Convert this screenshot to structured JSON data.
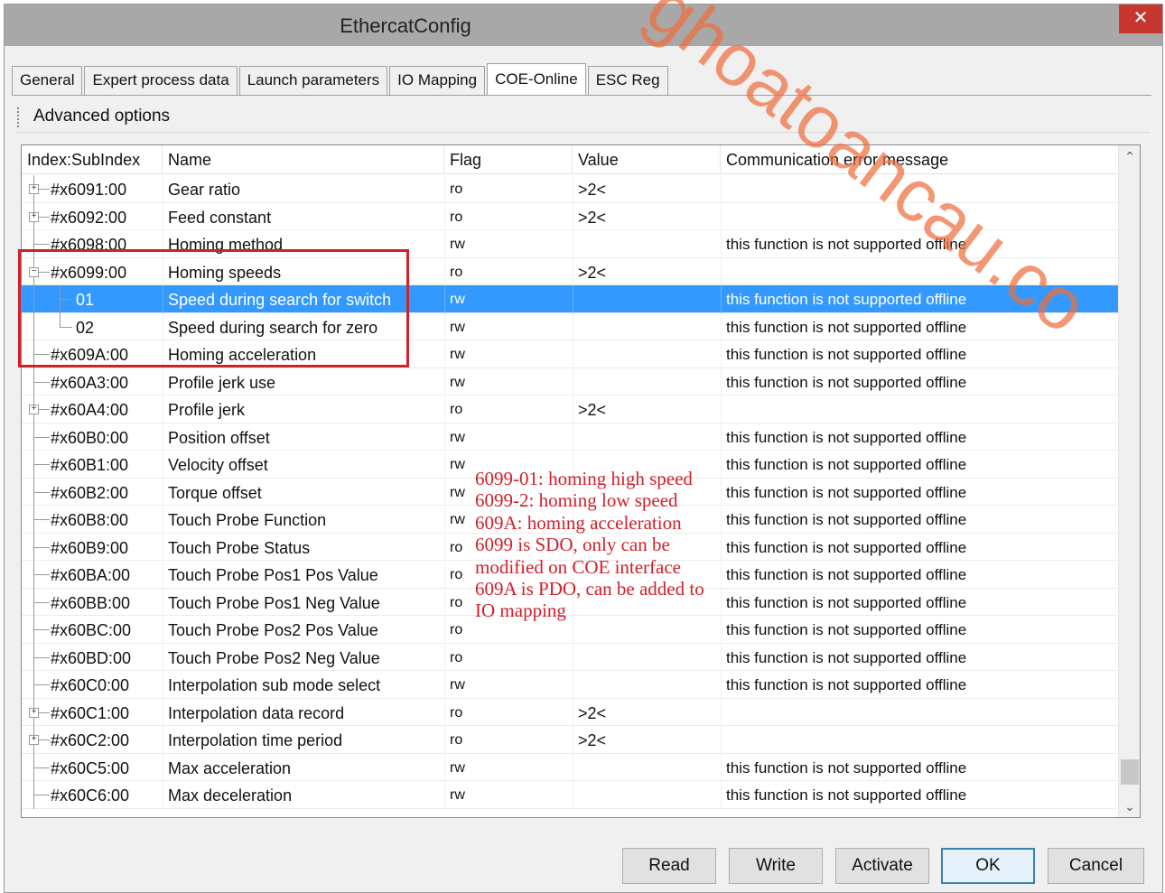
{
  "window": {
    "title": "EthercatConfig",
    "close_glyph": "✕"
  },
  "tabs": [
    {
      "label": "General"
    },
    {
      "label": "Expert process data"
    },
    {
      "label": "Launch parameters"
    },
    {
      "label": "IO Mapping"
    },
    {
      "label": "COE-Online",
      "active": true
    },
    {
      "label": "ESC Reg"
    }
  ],
  "advanced_options": {
    "label": "Advanced options"
  },
  "table": {
    "columns": [
      "Index:SubIndex",
      "Name",
      "Flag",
      "Value",
      "Communication error message"
    ],
    "rows": [
      {
        "index": "#x6091:00",
        "name": "Gear ratio",
        "flag": "ro",
        "value": ">2<",
        "error": "",
        "node": "expandable"
      },
      {
        "index": "#x6092:00",
        "name": "Feed constant",
        "flag": "ro",
        "value": ">2<",
        "error": "",
        "node": "expandable"
      },
      {
        "index": "#x6098:00",
        "name": "Homing method",
        "flag": "rw",
        "value": "",
        "error": "this function is not supported offline",
        "node": "leaf"
      },
      {
        "index": "#x6099:00",
        "name": "Homing speeds",
        "flag": "ro",
        "value": ">2<",
        "error": "",
        "node": "expanded"
      },
      {
        "index": "01",
        "name": "Speed during search for switch",
        "flag": "rw",
        "value": "",
        "error": "this function is not supported offline",
        "node": "child",
        "selected": true
      },
      {
        "index": "02",
        "name": "Speed during search for zero",
        "flag": "rw",
        "value": "",
        "error": "this function is not supported offline",
        "node": "child-last"
      },
      {
        "index": "#x609A:00",
        "name": "Homing acceleration",
        "flag": "rw",
        "value": "",
        "error": "this function is not supported offline",
        "node": "leaf"
      },
      {
        "index": "#x60A3:00",
        "name": "Profile jerk use",
        "flag": "rw",
        "value": "",
        "error": "this function is not supported offline",
        "node": "leaf"
      },
      {
        "index": "#x60A4:00",
        "name": "Profile jerk",
        "flag": "ro",
        "value": ">2<",
        "error": "",
        "node": "expandable"
      },
      {
        "index": "#x60B0:00",
        "name": "Position offset",
        "flag": "rw",
        "value": "",
        "error": "this function is not supported offline",
        "node": "leaf"
      },
      {
        "index": "#x60B1:00",
        "name": "Velocity offset",
        "flag": "rw",
        "value": "",
        "error": "this function is not supported offline",
        "node": "leaf"
      },
      {
        "index": "#x60B2:00",
        "name": "Torque offset",
        "flag": "rw",
        "value": "",
        "error": "this function is not supported offline",
        "node": "leaf"
      },
      {
        "index": "#x60B8:00",
        "name": "Touch Probe Function",
        "flag": "rw",
        "value": "",
        "error": "this function is not supported offline",
        "node": "leaf"
      },
      {
        "index": "#x60B9:00",
        "name": "Touch Probe Status",
        "flag": "ro",
        "value": "",
        "error": "this function is not supported offline",
        "node": "leaf"
      },
      {
        "index": "#x60BA:00",
        "name": "Touch Probe Pos1 Pos Value",
        "flag": "ro",
        "value": "",
        "error": "this function is not supported offline",
        "node": "leaf"
      },
      {
        "index": "#x60BB:00",
        "name": "Touch Probe Pos1 Neg Value",
        "flag": "ro",
        "value": "",
        "error": "this function is not supported offline",
        "node": "leaf"
      },
      {
        "index": "#x60BC:00",
        "name": "Touch Probe Pos2 Pos Value",
        "flag": "ro",
        "value": "",
        "error": "this function is not supported offline",
        "node": "leaf"
      },
      {
        "index": "#x60BD:00",
        "name": "Touch Probe Pos2 Neg Value",
        "flag": "ro",
        "value": "",
        "error": "this function is not supported offline",
        "node": "leaf"
      },
      {
        "index": "#x60C0:00",
        "name": "Interpolation sub mode select",
        "flag": "rw",
        "value": "",
        "error": "this function is not supported offline",
        "node": "leaf"
      },
      {
        "index": "#x60C1:00",
        "name": "Interpolation data record",
        "flag": "ro",
        "value": ">2<",
        "error": "",
        "node": "expandable"
      },
      {
        "index": "#x60C2:00",
        "name": "Interpolation time period",
        "flag": "ro",
        "value": ">2<",
        "error": "",
        "node": "expandable"
      },
      {
        "index": "#x60C5:00",
        "name": "Max acceleration",
        "flag": "rw",
        "value": "",
        "error": "this function is not supported offline",
        "node": "leaf"
      },
      {
        "index": "#x60C6:00",
        "name": "Max deceleration",
        "flag": "rw",
        "value": "",
        "error": "this function is not supported offline",
        "node": "leaf"
      }
    ]
  },
  "annotation": {
    "lines": [
      "6099-01: homing high speed",
      "6099-2: homing low speed",
      "609A: homing acceleration",
      "6099 is SDO, only can be",
      "modified on COE interface",
      "609A is PDO, can be added to",
      "IO mapping"
    ]
  },
  "watermark": {
    "text": "ghoatoancau.co"
  },
  "buttons": {
    "read": "Read",
    "write": "Write",
    "activate": "Activate",
    "ok": "OK",
    "cancel": "Cancel"
  },
  "scrollbar": {
    "up_glyph": "⌃",
    "down_glyph": "⌄"
  },
  "colors": {
    "selection": "#3399ff",
    "annotation": "#d0202a",
    "watermark": "#ef6e3e",
    "close_button": "#c7372f"
  }
}
